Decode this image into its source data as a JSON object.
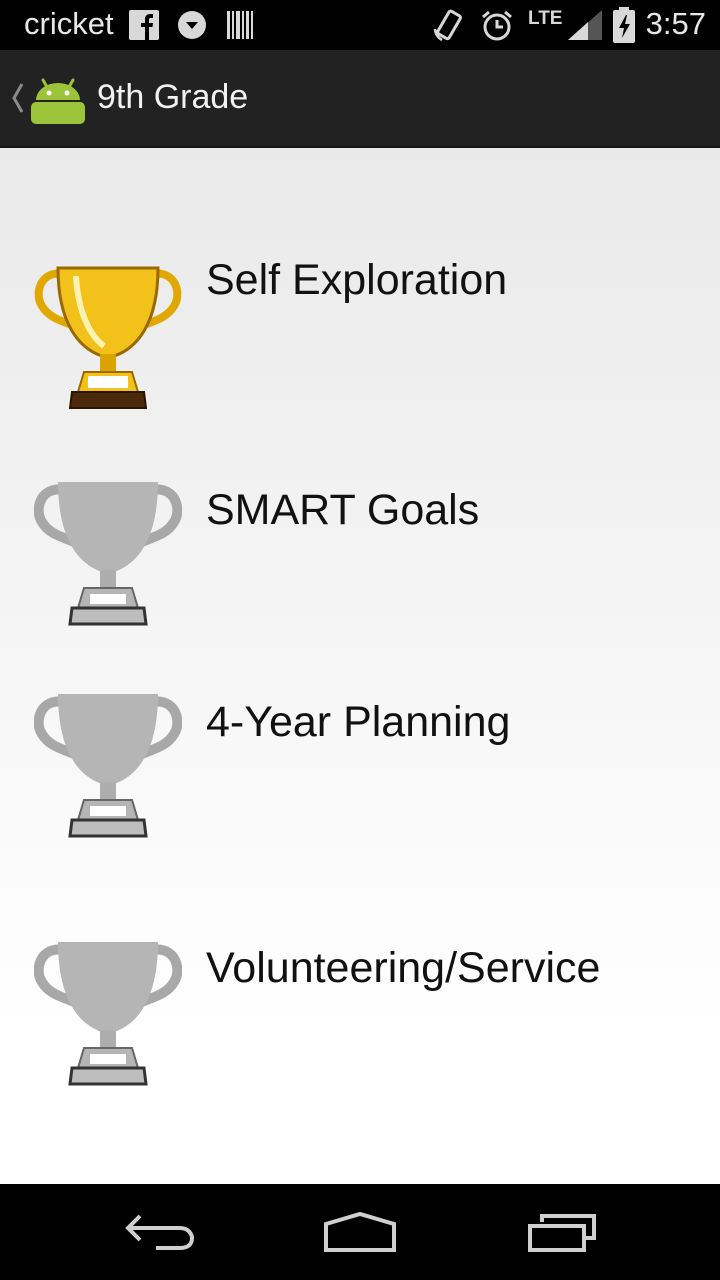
{
  "status_bar": {
    "carrier": "cricket",
    "network": "LTE",
    "time": "3:57",
    "icons": [
      "facebook-icon",
      "messenger-icon",
      "barcode-icon",
      "rotate-icon",
      "alarm-icon",
      "signal-icon",
      "battery-icon"
    ]
  },
  "action_bar": {
    "title": "9th Grade",
    "app_icon": "android-icon"
  },
  "achievements": [
    {
      "label": "Self Exploration",
      "trophy": "gold",
      "color": "#f2c21b"
    },
    {
      "label": "SMART Goals",
      "trophy": "gray",
      "color": "#b5b5b5"
    },
    {
      "label": "4-Year Planning",
      "trophy": "gray",
      "color": "#b5b5b5"
    },
    {
      "label": "Volunteering/Service",
      "trophy": "gray",
      "color": "#b5b5b5"
    }
  ],
  "nav_bar": {
    "buttons": [
      "back-icon",
      "home-icon",
      "recents-icon"
    ]
  }
}
